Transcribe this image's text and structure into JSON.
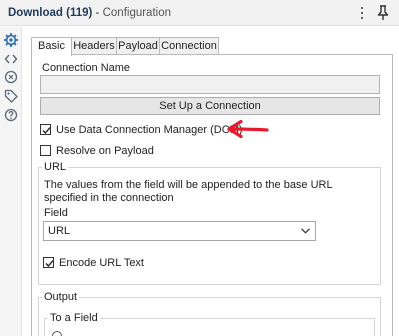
{
  "window": {
    "tool_name": "Download (119)",
    "separator": " - ",
    "panel_title": "Configuration",
    "menu_icon": "kebab-menu-icon",
    "pin_icon": "pin-icon"
  },
  "side_rail": {
    "icons": [
      "gear-icon",
      "code-icon",
      "settings-circle-icon",
      "tag-icon",
      "help-icon"
    ]
  },
  "tabs": [
    {
      "label": "Basic",
      "active": true
    },
    {
      "label": "Headers",
      "active": false
    },
    {
      "label": "Payload",
      "active": false
    },
    {
      "label": "Connection",
      "active": false
    }
  ],
  "connection": {
    "name_label": "Connection Name",
    "name_value": "",
    "setup_button": "Set Up a Connection",
    "use_dcm_label": "Use Data Connection Manager (DCM)",
    "use_dcm_checked": true,
    "resolve_label": "Resolve on Payload",
    "resolve_checked": false
  },
  "url_group": {
    "legend": "URL",
    "description": "The values from the field will be appended to the base URL specified in the connection",
    "field_label": "Field",
    "field_value": "URL",
    "encode_label": "Encode URL Text",
    "encode_checked": true
  },
  "output_group": {
    "legend": "Output",
    "sub_legend": "To a Field"
  },
  "annotation": {
    "color": "#e8192c"
  }
}
